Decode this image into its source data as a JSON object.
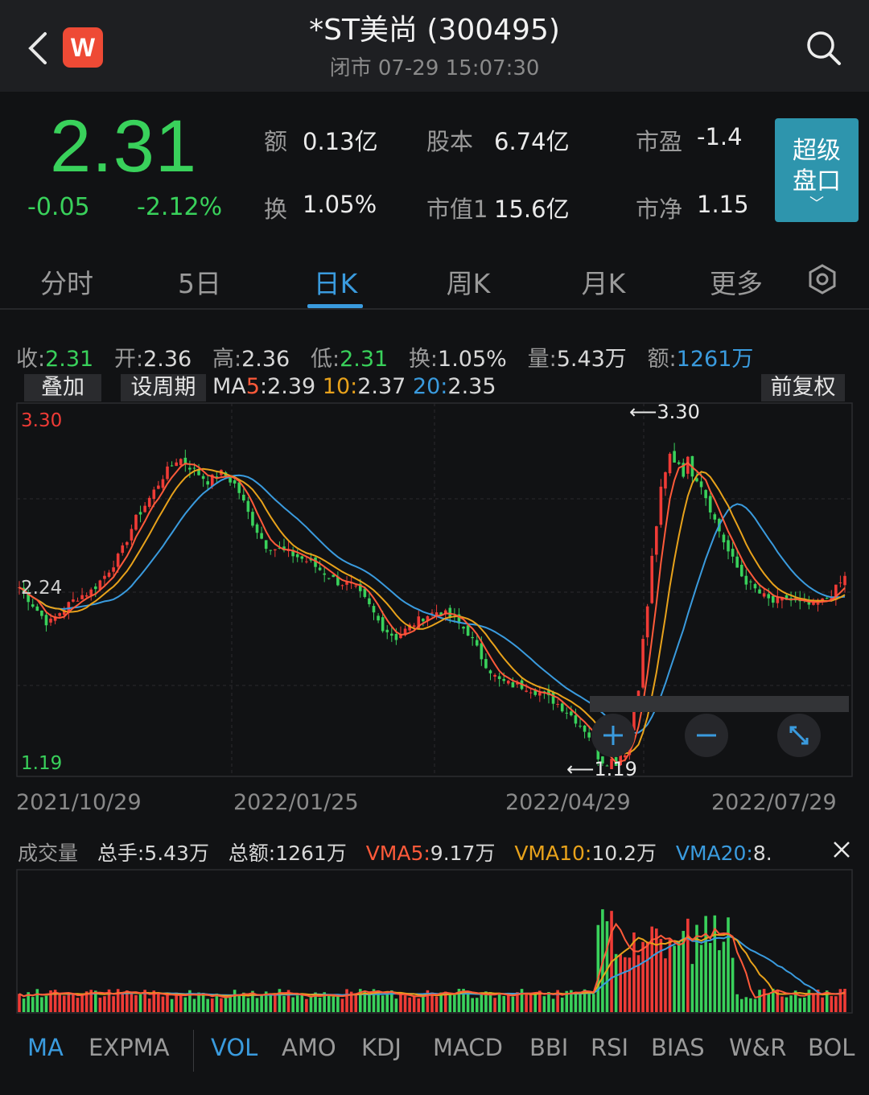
{
  "header": {
    "title": "*ST美尚 (300495)",
    "subtitle": "闭市 07-29 15:07:30",
    "logo": "W"
  },
  "quote": {
    "price": "2.31",
    "change": "-0.05",
    "change_pct": "-2.12%",
    "stats": [
      {
        "label": "额",
        "value": "0.13亿"
      },
      {
        "label": "股本",
        "value": "6.74亿"
      },
      {
        "label": "市盈",
        "value": "-1.4"
      },
      {
        "label": "换",
        "value": "1.05%"
      },
      {
        "label": "市值1",
        "value": "15.6亿"
      },
      {
        "label": "市净",
        "value": "1.15"
      }
    ],
    "super_button": {
      "line1": "超级",
      "line2": "盘口",
      "chevron": "﹀"
    }
  },
  "tabs": [
    "分时",
    "5日",
    "日K",
    "周K",
    "月K",
    "更多"
  ],
  "active_tab": "日K",
  "info_line": {
    "close_label": "收:",
    "close": "2.31",
    "open_label": "开:",
    "open": "2.36",
    "high_label": "高:",
    "high": "2.36",
    "low_label": "低:",
    "low": "2.31",
    "turnover_label": "换:",
    "turnover": "1.05%",
    "volume_label": "量:",
    "volume": "5.43万",
    "amount_label": "额:",
    "amount": "1261万"
  },
  "chart_controls": {
    "overlay": "叠加",
    "period": "设周期",
    "ma5_label": "MA5:",
    "ma5": "2.39",
    "ma10_label": "10:",
    "ma10": "2.37",
    "ma20_label": "20:",
    "ma20": "2.35",
    "adjust": "前复权"
  },
  "colors": {
    "up": "#ef3b36",
    "down": "#39d15b",
    "ma5": "#ff5a3a",
    "ma10": "#e8a21b",
    "ma20": "#3a9bde",
    "accent": "#3a9bde"
  },
  "chart_data": {
    "type": "candlestick",
    "y_labels": [
      "3.30",
      "2.24",
      "1.19"
    ],
    "ylim": [
      1.19,
      3.3
    ],
    "max_annotation": "3.30",
    "min_annotation": "1.19",
    "x_labels": [
      "2021/10/29",
      "2022/01/25",
      "2022/04/29",
      "2022/07/29"
    ],
    "ma_close_path": [
      2.25,
      2.14,
      2.03,
      2.12,
      2.19,
      2.23,
      2.33,
      2.45,
      2.65,
      2.78,
      2.92,
      3.02,
      2.95,
      2.88,
      2.93,
      2.85,
      2.65,
      2.5,
      2.47,
      2.44,
      2.4,
      2.34,
      2.28,
      2.26,
      2.16,
      2.02,
      1.95,
      2.02,
      2.08,
      2.11,
      2.06,
      1.98,
      1.82,
      1.7,
      1.67,
      1.66,
      1.62,
      1.57,
      1.5,
      1.41,
      1.29,
      1.2,
      1.35,
      1.85,
      2.65,
      3.05,
      2.97,
      2.88,
      2.65,
      2.45,
      2.3,
      2.22,
      2.16,
      2.18,
      2.15,
      2.14,
      2.2,
      2.31
    ],
    "volume_panel": {
      "summary_label": "成交量",
      "total_hands": "总手:5.43万",
      "total_amount": "总额:1261万",
      "vma5_label": "VMA5:",
      "vma5": "9.17万",
      "vma10_label": "VMA10:",
      "vma10": "10.2万",
      "vma20_label": "VMA20:",
      "vma20": "8."
    }
  },
  "indicators": [
    "MA",
    "EXPMA",
    "VOL",
    "AMO",
    "KDJ",
    "MACD",
    "BBI",
    "RSI",
    "BIAS",
    "W&R",
    "BOL"
  ],
  "active_indicators": [
    "MA",
    "VOL"
  ]
}
